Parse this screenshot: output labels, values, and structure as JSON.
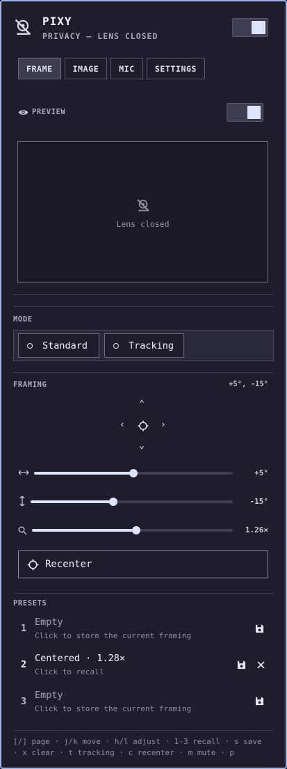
{
  "header": {
    "title": "PIXY",
    "subtitle": "PRIVACY — LENS CLOSED",
    "icon": "camera-off-icon",
    "privacy_toggle": true
  },
  "tabs": [
    {
      "label": "FRAME",
      "active": true
    },
    {
      "label": "IMAGE",
      "active": false
    },
    {
      "label": "MIC",
      "active": false
    },
    {
      "label": "SETTINGS",
      "active": false
    }
  ],
  "preview": {
    "label": "PREVIEW",
    "toggle_on": true,
    "status": "Lens closed"
  },
  "mode": {
    "label": "MODE",
    "options": [
      "Standard",
      "Tracking"
    ]
  },
  "framing": {
    "label": "FRAMING",
    "value": "+5°, -15°",
    "sliders": [
      {
        "name": "pan",
        "icon": "horizontal-arrows-icon",
        "fraction": 0.5,
        "value": "+5°"
      },
      {
        "name": "tilt",
        "icon": "vertical-arrows-icon",
        "fraction": 0.41,
        "value": "-15°"
      },
      {
        "name": "zoom",
        "icon": "zoom-icon",
        "fraction": 0.52,
        "value": "1.26×"
      }
    ],
    "recenter_label": "Recenter"
  },
  "presets": {
    "label": "PRESETS",
    "items": [
      {
        "num": "1",
        "title": "Empty",
        "sub": "Click to store the current framing",
        "filled": false
      },
      {
        "num": "2",
        "title": "Centered · 1.28×",
        "sub": "Click to recall",
        "filled": true
      },
      {
        "num": "3",
        "title": "Empty",
        "sub": "Click to store the current framing",
        "filled": false
      }
    ]
  },
  "footer": {
    "line1": "[/] page · j/k move · h/l adjust · 1-3 recall · s save",
    "line2": "· x clear · t tracking · c recenter · m mute · p"
  },
  "colors": {
    "background": "#1f1d2b",
    "accent": "#dde4ff",
    "border": "#9bb4f0"
  }
}
